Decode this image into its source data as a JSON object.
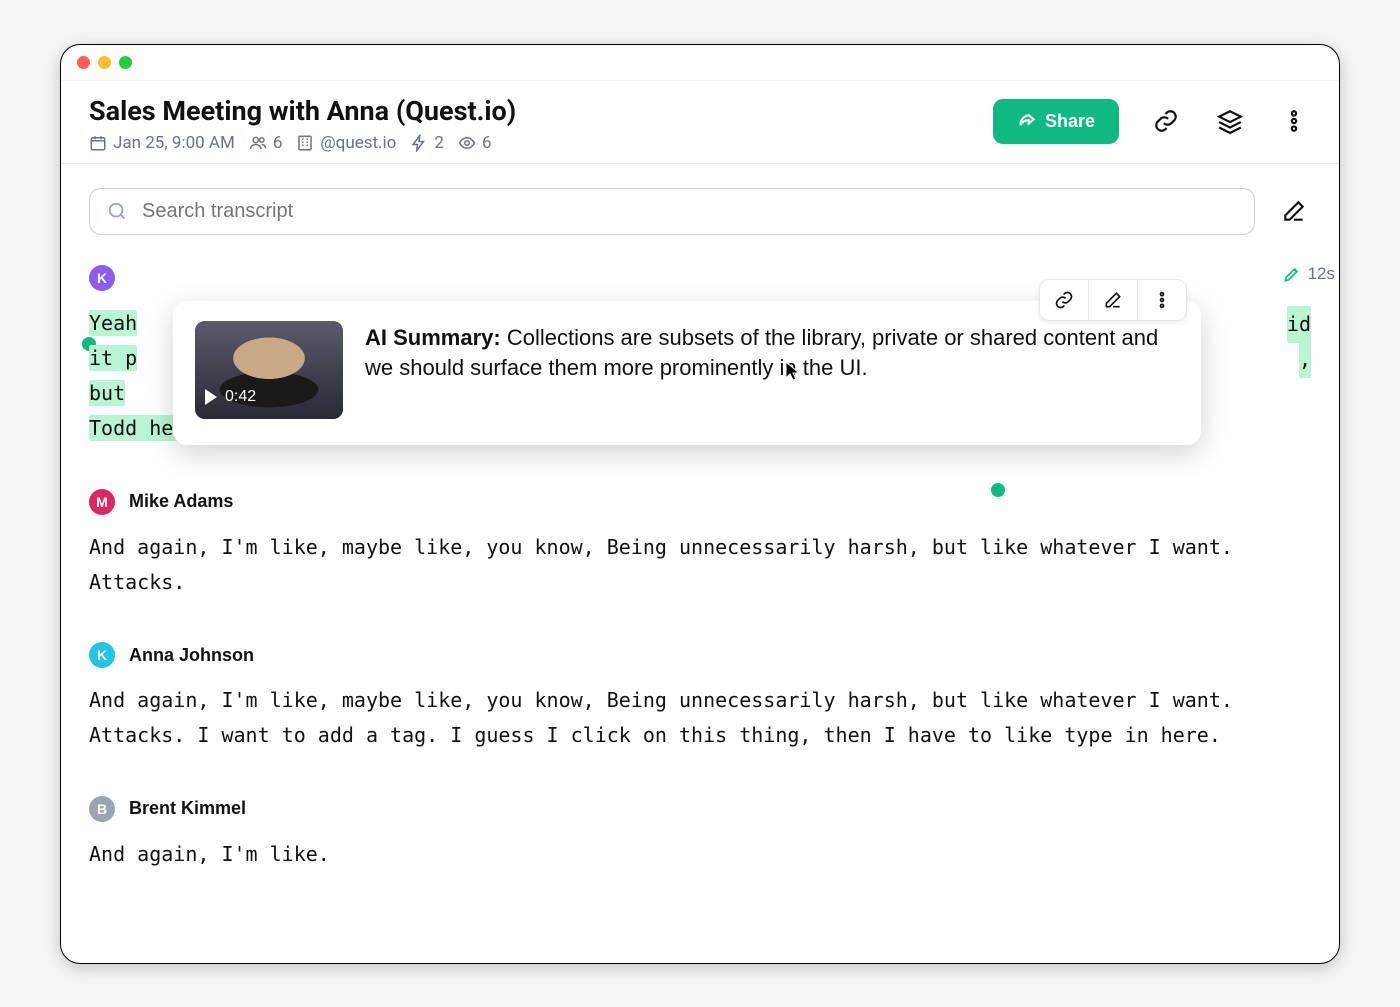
{
  "header": {
    "title": "Sales Meeting with Anna (Quest.io)",
    "date": "Jan 25, 9:00 AM",
    "participants": "6",
    "org": "@quest.io",
    "actions": "2",
    "views": "6",
    "share_label": "Share"
  },
  "search": {
    "placeholder": "Search transcript"
  },
  "avatars": {
    "k": {
      "initial": "K",
      "color": "#8B5CF6"
    },
    "m": {
      "initial": "M",
      "color": "#DC2662"
    },
    "k2": {
      "initial": "K",
      "color": "#22c3e6"
    },
    "b": {
      "initial": "B",
      "color": "#9CA3AF"
    }
  },
  "summary": {
    "label": "AI Summary:",
    "text": "Collections are subsets of the library, private or shared content and we should surface them more prominently in the UI.",
    "video_time": "0:42"
  },
  "time_badge": "12s",
  "transcript": {
    "blocks": [
      {
        "speaker": "K",
        "highlighted": true,
        "line1_pre": "Yeah",
        "line1_post": "id",
        "line2_pre": "it p",
        "line2_post": ",",
        "line3_pre": "but",
        "line4": "Todd here is every single thing with Todd and it's just like, I don't care."
      },
      {
        "speaker": "Mike Adams",
        "text": "And again, I'm like, maybe like, you know, Being unnecessarily harsh, but like whatever I want. Attacks."
      },
      {
        "speaker": "Anna Johnson",
        "text": "And again, I'm like, maybe like, you know, Being unnecessarily harsh, but like whatever I want. Attacks. I want to add a tag. I guess I click on this thing, then I have to like type in here."
      },
      {
        "speaker": "Brent Kimmel",
        "text": "And again, I'm like."
      }
    ]
  }
}
